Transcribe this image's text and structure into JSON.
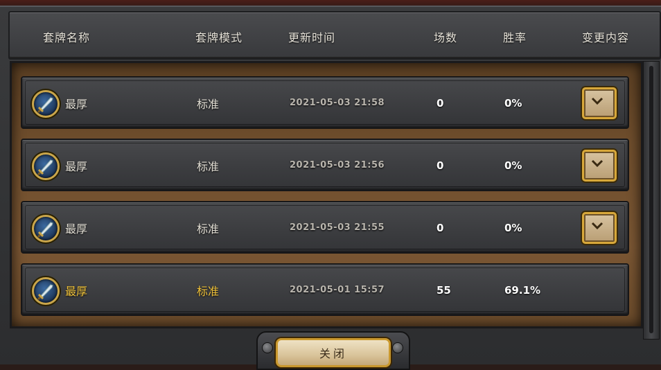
{
  "header": {
    "deck_name": "套牌名称",
    "deck_mode": "套牌模式",
    "updated_time": "更新时间",
    "games": "场数",
    "win_rate": "胜率",
    "changes": "变更内容"
  },
  "rows": [
    {
      "name": "最厚",
      "mode": "标准",
      "time": "2021-05-03  21:58",
      "games": "0",
      "win_rate": "0%",
      "has_expand": true
    },
    {
      "name": "最厚",
      "mode": "标准",
      "time": "2021-05-03  21:56",
      "games": "0",
      "win_rate": "0%",
      "has_expand": true
    },
    {
      "name": "最厚",
      "mode": "标准",
      "time": "2021-05-03  21:55",
      "games": "0",
      "win_rate": "0%",
      "has_expand": true
    },
    {
      "name": "最厚",
      "mode": "标准",
      "time": "2021-05-01  15:57",
      "games": "55",
      "win_rate": "69.1%",
      "has_expand": false
    }
  ],
  "close_label": "关闭",
  "icons": {
    "deck_class": "sword-icon",
    "expand": "chevron-down-icon"
  },
  "colors": {
    "highlight": "#f0c23a",
    "panel": "#6e4d2c",
    "button_border": "#d8a83a"
  }
}
